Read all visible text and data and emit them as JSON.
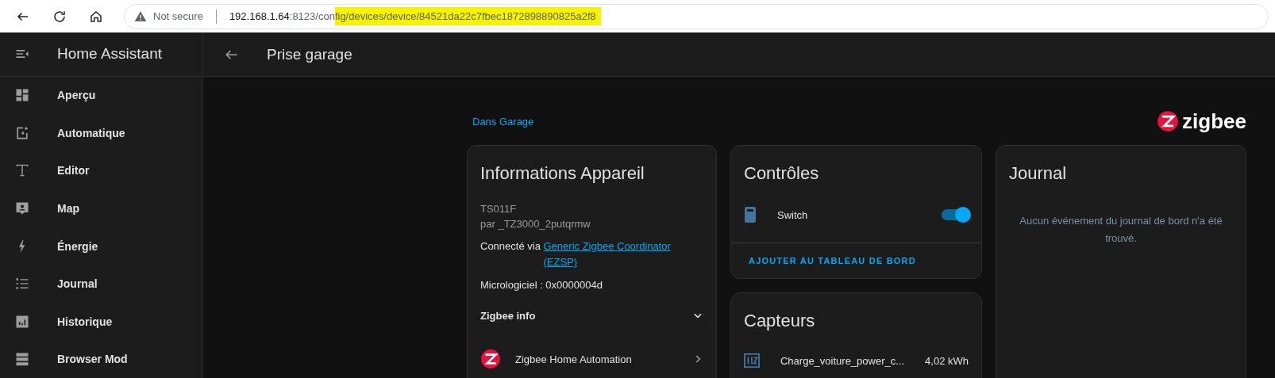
{
  "browser": {
    "security": "Not secure",
    "url_parts": [
      {
        "text": "192.168.1.64",
        "kind": "host",
        "highlighted": false
      },
      {
        "text": ":8123/con",
        "kind": "path",
        "highlighted": false
      },
      {
        "text": "fig/devices/device/84521da22c7fbec1872898890825a2f8",
        "kind": "path",
        "highlighted": true
      }
    ]
  },
  "sidebar": {
    "title": "Home Assistant",
    "items": [
      {
        "label": "Aperçu"
      },
      {
        "label": "Automatique"
      },
      {
        "label": "Editor"
      },
      {
        "label": "Map"
      },
      {
        "label": "Énergie"
      },
      {
        "label": "Journal"
      },
      {
        "label": "Historique"
      },
      {
        "label": "Browser Mod"
      }
    ]
  },
  "toolbar": {
    "title": "Prise garage"
  },
  "area_link": "Dans Garage",
  "brand": "zigbee",
  "device_info": {
    "title": "Informations Appareil",
    "model": "TS011F",
    "manufacturer": "par _TZ3000_2putqrmw",
    "connected_prefix": "Connecté via ",
    "connected_link": "Generic Zigbee Coordinator (EZSP)",
    "firmware": "Micrologiciel : 0x0000004d",
    "section": {
      "label": "Zigbee info",
      "expanded": false
    },
    "integration": "Zigbee Home Automation"
  },
  "controls": {
    "title": "Contrôles",
    "entities": [
      {
        "name": "Switch",
        "on": true
      }
    ],
    "action": "AJOUTER AU TABLEAU DE BORD"
  },
  "sensors": {
    "title": "Capteurs",
    "entities": [
      {
        "name": "Charge_voiture_power_c...",
        "value": "4,02 kWh"
      }
    ]
  },
  "logbook": {
    "title": "Journal",
    "empty": "Aucun événement du journal de bord n'a été trouvé."
  }
}
